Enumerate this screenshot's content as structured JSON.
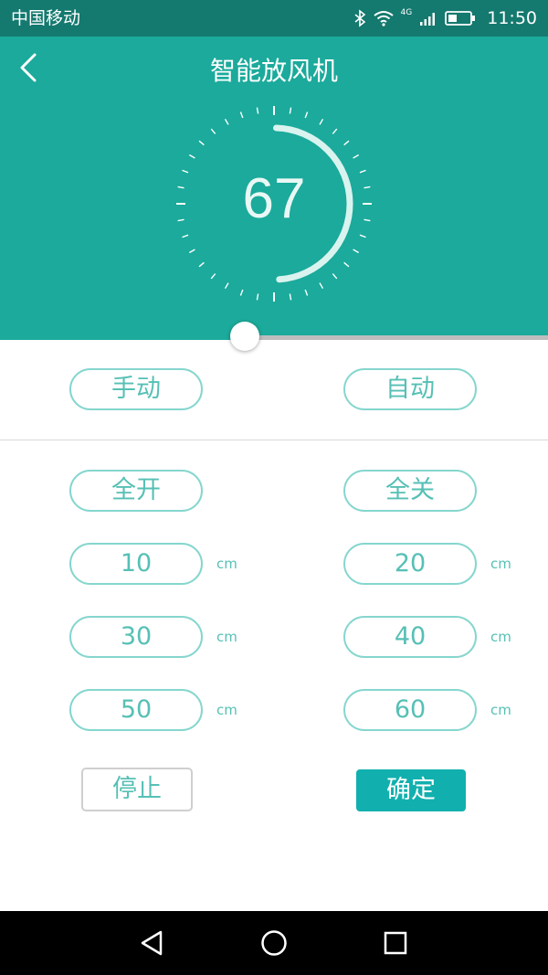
{
  "status_bar": {
    "carrier": "中国移动",
    "network": "4G",
    "time": "11:50",
    "icons": [
      "bluetooth-icon",
      "wifi-icon",
      "signal-icon",
      "battery-icon"
    ]
  },
  "header": {
    "title": "智能放风机",
    "back_icon": "chevron-left-icon",
    "background": "#1baa9b"
  },
  "dial": {
    "value": "67",
    "level_fraction": 0.5
  },
  "slider": {
    "value_fraction": 0.45
  },
  "mode": {
    "manual_label": "手动",
    "auto_label": "自动"
  },
  "presets": {
    "open_all_label": "全开",
    "close_all_label": "全关",
    "unit": "cm",
    "values": [
      "10",
      "20",
      "30",
      "40",
      "50",
      "60"
    ]
  },
  "actions": {
    "stop_label": "停止",
    "confirm_label": "确定"
  },
  "colors": {
    "accent": "#1baa9b",
    "button_text": "#56c0b5",
    "confirm": "#11b0ae"
  },
  "navbar": {
    "icons": [
      "back-triangle-icon",
      "home-circle-icon",
      "recents-square-icon"
    ]
  }
}
